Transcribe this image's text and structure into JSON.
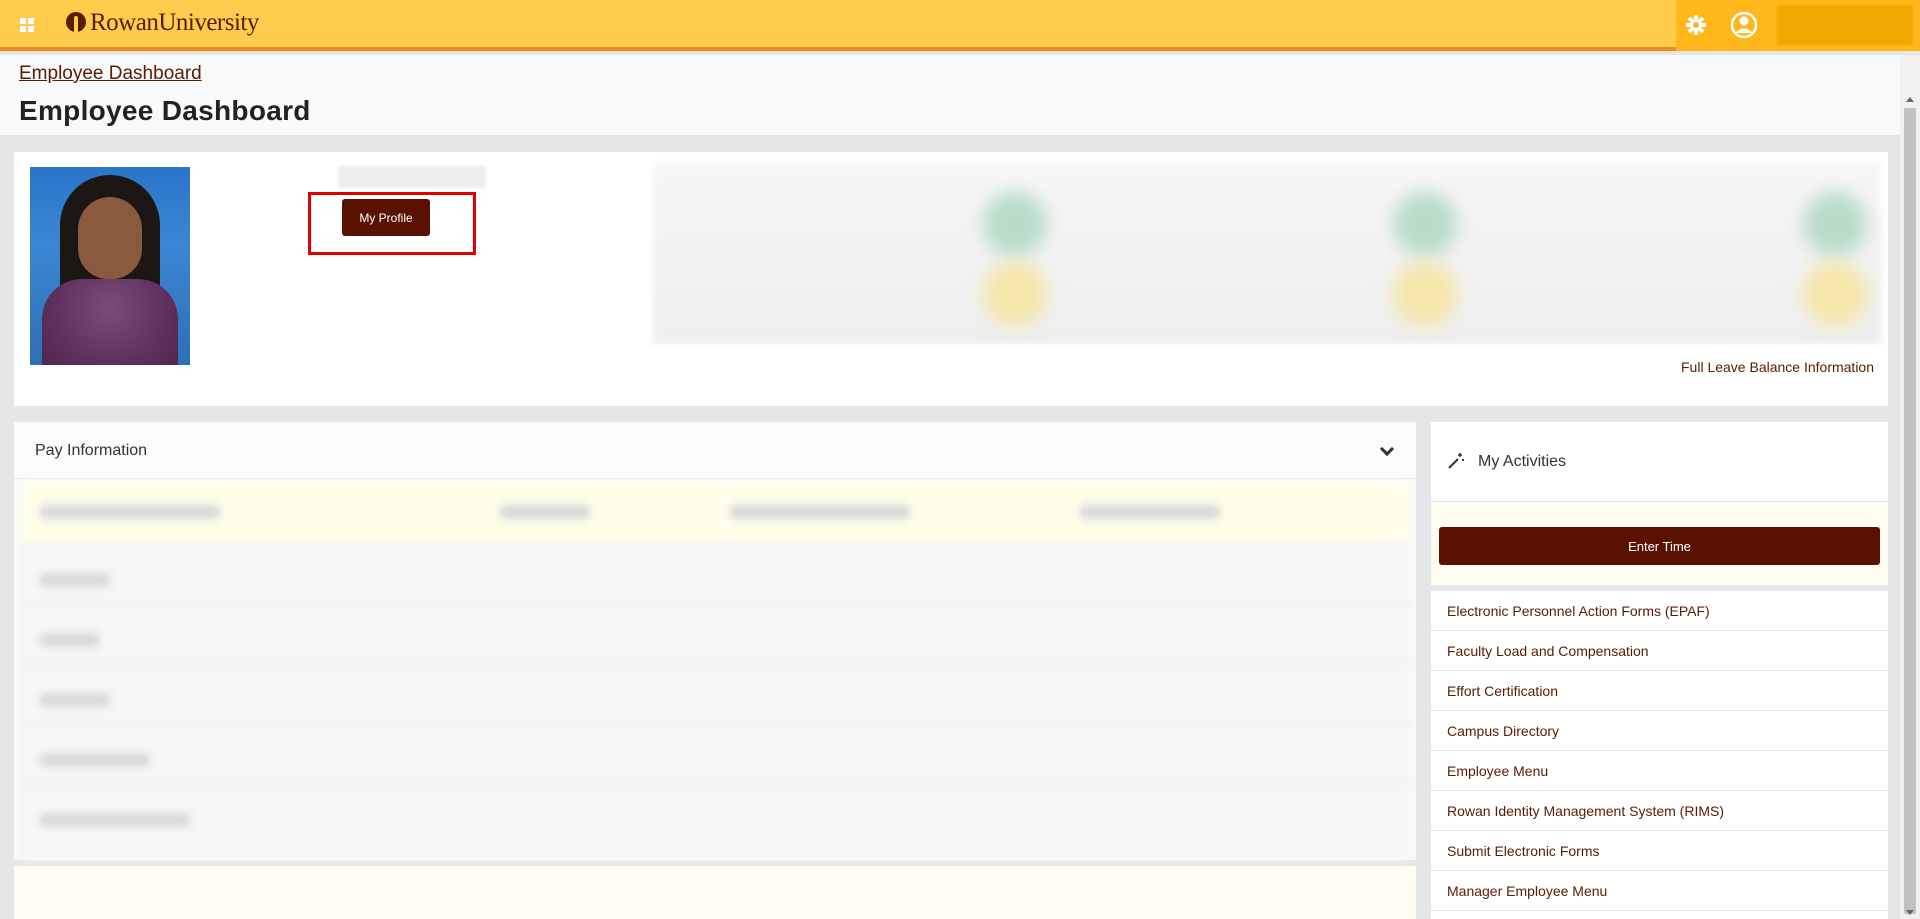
{
  "header": {
    "app_grid_icon": "grid-icon",
    "logo_text": "RowanUniversity",
    "settings_icon": "gear-icon",
    "user_icon": "user-circle-icon"
  },
  "page": {
    "breadcrumb": "Employee Dashboard",
    "title": "Employee Dashboard"
  },
  "profile": {
    "my_profile_label": "My Profile",
    "full_leave_link": "Full Leave Balance Information"
  },
  "pay": {
    "title": "Pay Information",
    "toggle_icon": "chevron-down-icon"
  },
  "activities": {
    "title": "My Activities",
    "icon": "magic-wand-icon",
    "enter_time_label": "Enter Time",
    "items": [
      {
        "label": "Electronic Personnel Action Forms (EPAF)"
      },
      {
        "label": "Faculty Load and Compensation"
      },
      {
        "label": "Effort Certification"
      },
      {
        "label": "Campus Directory"
      },
      {
        "label": "Employee Menu"
      },
      {
        "label": "Rowan Identity Management System (RIMS)"
      },
      {
        "label": "Submit Electronic Forms"
      },
      {
        "label": "Manager Employee Menu"
      }
    ]
  },
  "colors": {
    "header_bg": "#ffcc4e",
    "header_accent": "#f08a1c",
    "brand_brown": "#5a1200",
    "highlight_red": "#e00000"
  }
}
